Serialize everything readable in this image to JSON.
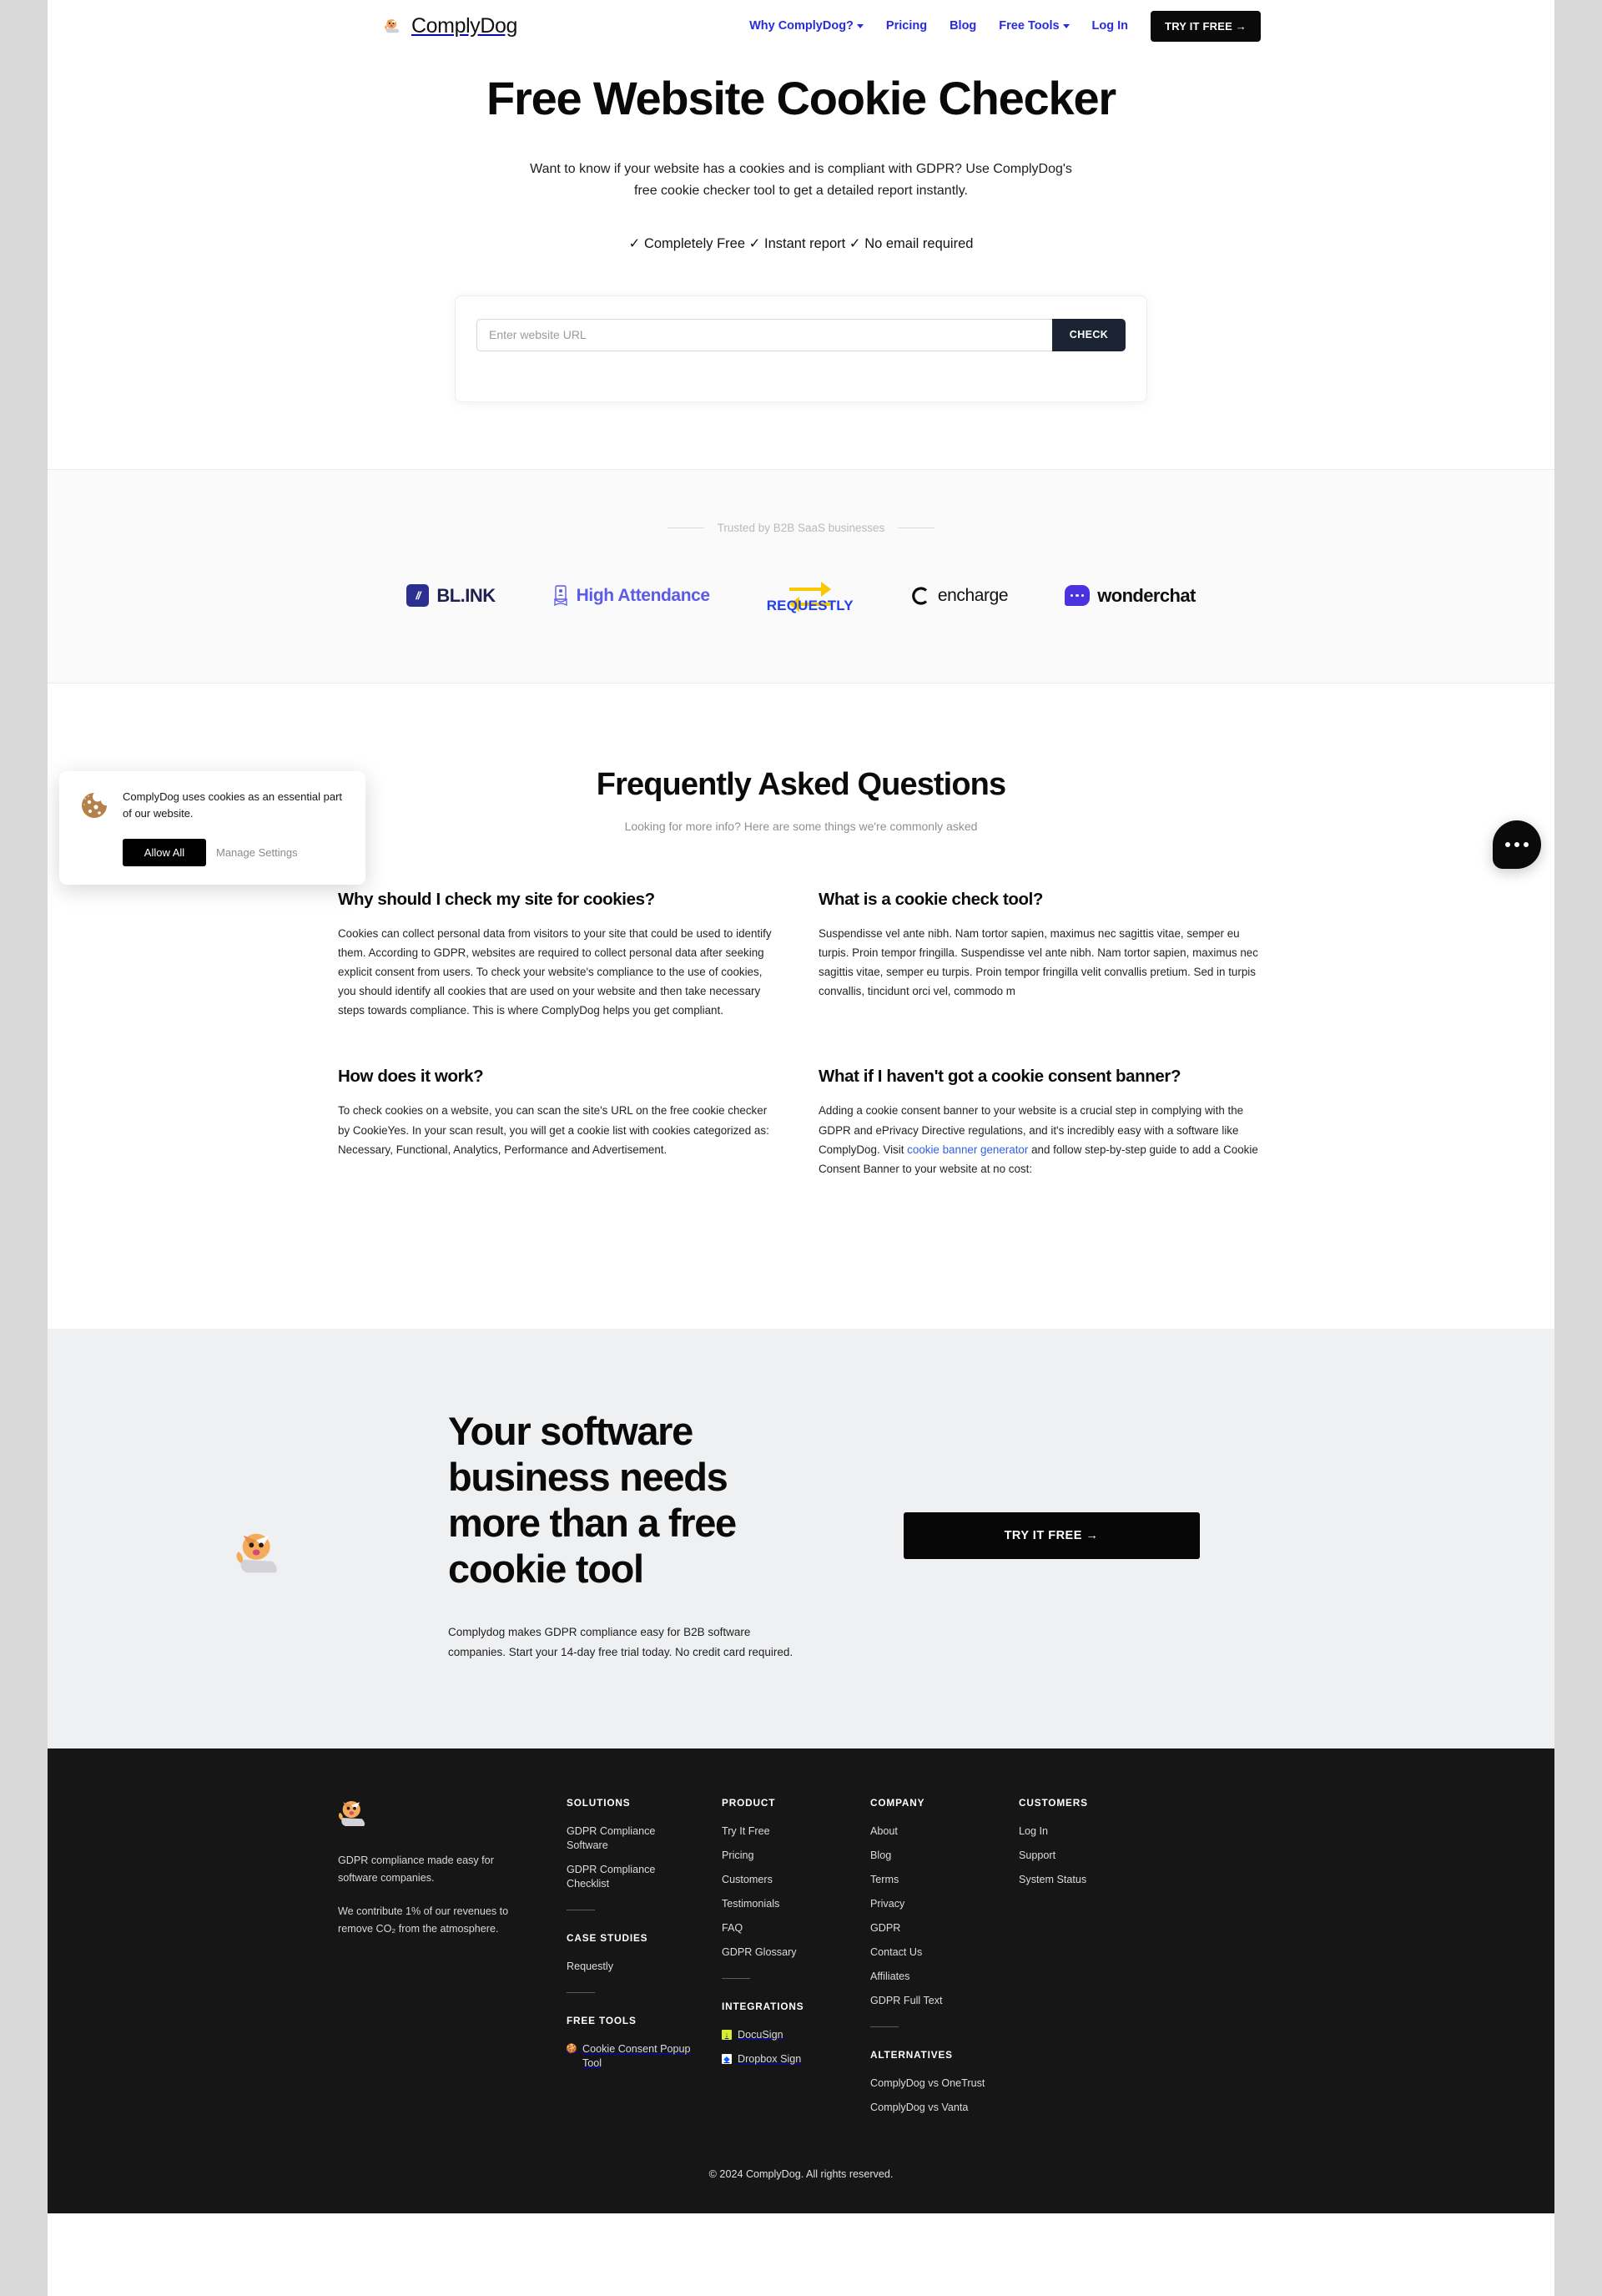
{
  "header": {
    "brand": "ComplyDog",
    "brand_icon": "dog-logo-icon",
    "nav": [
      {
        "label": "Why ComplyDog?",
        "has_caret": true
      },
      {
        "label": "Pricing",
        "has_caret": false
      },
      {
        "label": "Blog",
        "has_caret": false
      },
      {
        "label": "Free Tools",
        "has_caret": true
      },
      {
        "label": "Log In",
        "has_caret": false
      }
    ],
    "cta_label": "TRY IT FREE →",
    "link_color": "#2a2ae0"
  },
  "hero": {
    "title": "Free Website Cookie Checker",
    "subtitle": "Want to know if your website has a cookies and is compliant with GDPR? Use ComplyDog's free cookie checker tool to get a detailed report instantly.",
    "bullets": "✓ Completely Free ✓ Instant report ✓ No email required",
    "input_placeholder": "Enter website URL",
    "input_value": "",
    "check_label": "CHECK"
  },
  "trust": {
    "label": "Trusted by B2B SaaS businesses",
    "logos": [
      {
        "name": "BL.INK",
        "mark": "//"
      },
      {
        "name": "High Attendance"
      },
      {
        "name": "REQUESTLY"
      },
      {
        "name": "encharge"
      },
      {
        "name": "wonderchat"
      }
    ]
  },
  "faq": {
    "title": "Frequently Asked Questions",
    "subtitle": "Looking for more info? Here are some things we're commonly asked",
    "items": [
      {
        "question": "Why should I check my site for cookies?",
        "answer": "Cookies can collect personal data from visitors to your site that could be used to identify them. According to GDPR, websites are required to collect personal data after seeking explicit consent from users. To check your website's compliance to the use of cookies, you should identify all cookies that are used on your website and then take necessary steps towards compliance. This is where ComplyDog helps you get compliant."
      },
      {
        "question": "What is a cookie check tool?",
        "answer": "Suspendisse vel ante nibh. Nam tortor sapien, maximus nec sagittis vitae, semper eu turpis. Proin tempor fringilla. Suspendisse vel ante nibh. Nam tortor sapien, maximus nec sagittis vitae, semper eu turpis. Proin tempor fringilla velit convallis pretium. Sed in turpis convallis, tincidunt orci vel, commodo m"
      },
      {
        "question": "How does it work?",
        "answer": "To check cookies on a website, you can scan the site's URL on the free cookie checker by CookieYes. In your scan result, you will get a cookie list with cookies categorized as: Necessary, Functional, Analytics, Performance and Advertisement."
      },
      {
        "question": "What if I haven't got a cookie consent banner?",
        "answer_part1": "Adding a cookie consent banner to your website is a crucial step in complying with the GDPR and ePrivacy Directive regulations, and it's incredibly easy with a software like ComplyDog. Visit ",
        "answer_link": "cookie banner generator",
        "answer_part2": " and follow step-by-step guide to add a Cookie Consent Banner to your website at no cost:"
      }
    ]
  },
  "cta": {
    "title": "Your software business needs more than a free cookie tool",
    "text": "Complydog makes GDPR compliance easy for B2B software companies. Start your 14-day free trial today. No credit card required.",
    "button_label": "TRY IT FREE →",
    "dog_icon": "dog-logo-icon"
  },
  "footer": {
    "brand_icon": "dog-logo-icon",
    "tagline": "GDPR compliance made easy for software companies.",
    "co2_note": "We contribute 1% of our revenues to remove CO₂ from the atmosphere.",
    "columns": [
      {
        "head": "SOLUTIONS",
        "links": [
          "GDPR Compliance Software",
          "GDPR Compliance Checklist"
        ],
        "head2": "CASE STUDIES",
        "links2": [
          "Requestly"
        ],
        "head3": "FREE TOOLS",
        "links3": [
          {
            "label": "Cookie Consent Popup Tool",
            "icon": "cookie-icon"
          }
        ]
      },
      {
        "head": "PRODUCT",
        "links": [
          "Try It Free",
          "Pricing",
          "Customers",
          "Testimonials",
          "FAQ",
          "GDPR Glossary"
        ],
        "head2": "INTEGRATIONS",
        "links2": [
          {
            "label": "DocuSign",
            "icon": "docusign-icon"
          },
          {
            "label": "Dropbox Sign",
            "icon": "dropbox-icon"
          }
        ]
      },
      {
        "head": "COMPANY",
        "links": [
          "About",
          "Blog",
          "Terms",
          "Privacy",
          "GDPR",
          "Contact Us",
          "Affiliates",
          "GDPR Full Text"
        ],
        "head2": "ALTERNATIVES",
        "links2": [
          "ComplyDog vs OneTrust",
          "ComplyDog vs Vanta"
        ]
      },
      {
        "head": "CUSTOMERS",
        "links": [
          "Log In",
          "Support",
          "System Status"
        ]
      }
    ],
    "copyright": "© 2024 ComplyDog. All rights reserved."
  },
  "cookie_banner": {
    "icon": "cookie-icon",
    "text": "ComplyDog uses cookies as an essential part of our website.",
    "allow_label": "Allow All",
    "manage_label": "Manage Settings"
  },
  "chat": {
    "icon": "chat-bubble-icon"
  }
}
